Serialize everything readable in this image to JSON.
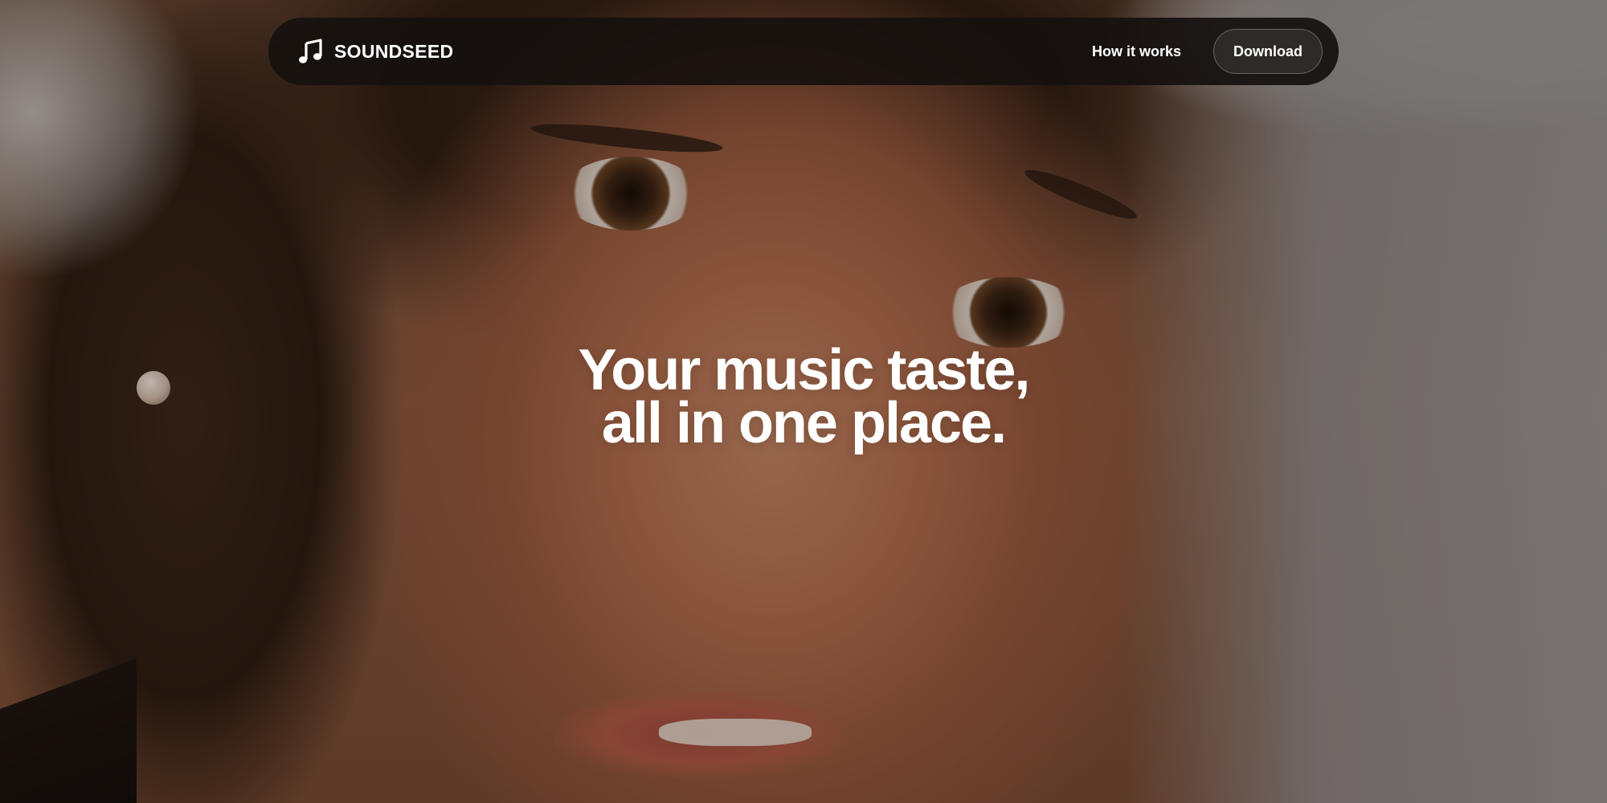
{
  "nav": {
    "brand_name": "SOUNDSEED",
    "brand_icon": "music-note-icon",
    "links": [
      {
        "label": "How it works"
      }
    ],
    "cta_label": "Download"
  },
  "hero": {
    "headline_line1": "Your music taste,",
    "headline_line2": "all in one place."
  },
  "colors": {
    "navbar_bg": "#16110f",
    "text": "#ffffff"
  }
}
